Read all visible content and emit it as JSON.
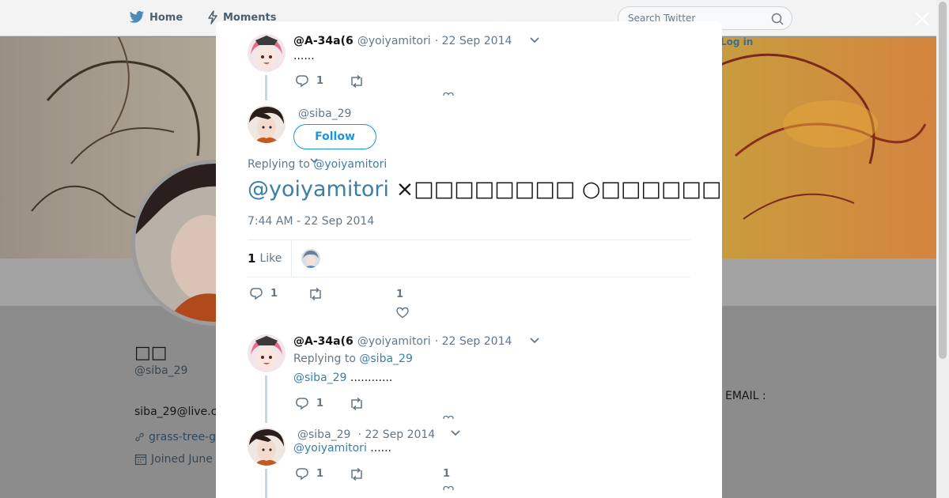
{
  "topbar": {
    "home_label": "Home",
    "moments_label": "Moments",
    "search_placeholder": "Search Twitter",
    "login_label": "Log in"
  },
  "profile": {
    "name": "□□",
    "handle": "@siba_29",
    "email": "siba_29@live.c",
    "link": "grass-tree-g",
    "joined": "Joined June",
    "right_text": "EMAIL :"
  },
  "modal": {
    "tweet1": {
      "fullname": "@A-34a(6",
      "username": "@yoiyamitori",
      "date": "· 22 Sep 2014",
      "text": "......",
      "replies": "1"
    },
    "main": {
      "username": "@siba_29",
      "follow_label": "Follow",
      "replying_prefix": "Replying to",
      "replying_to": "@yoiyamitori",
      "mention": "@yoiyamitori",
      "body": " ×□□□□□□□□  ○□□□□□□□□",
      "timestamp": "7:44 AM - 22 Sep 2014",
      "likes_count": "1",
      "likes_label": "Like",
      "replies": "1",
      "likes_action": "1"
    },
    "tweet3": {
      "fullname": "@A-34a(6",
      "username": "@yoiyamitori",
      "date": "· 22 Sep 2014",
      "replying_prefix": "Replying to",
      "replying_to": "@siba_29",
      "mention": "@siba_29",
      "text": " ............",
      "replies": "1"
    },
    "tweet4": {
      "username": "@siba_29",
      "date": "· 22 Sep 2014",
      "mention": "@yoiyamitori",
      "text": " ......",
      "replies": "1",
      "likes": "1"
    }
  },
  "colors": {
    "accent": "#1b95e0",
    "muted": "#657786",
    "overlay_bg": "#8e8e8e"
  }
}
